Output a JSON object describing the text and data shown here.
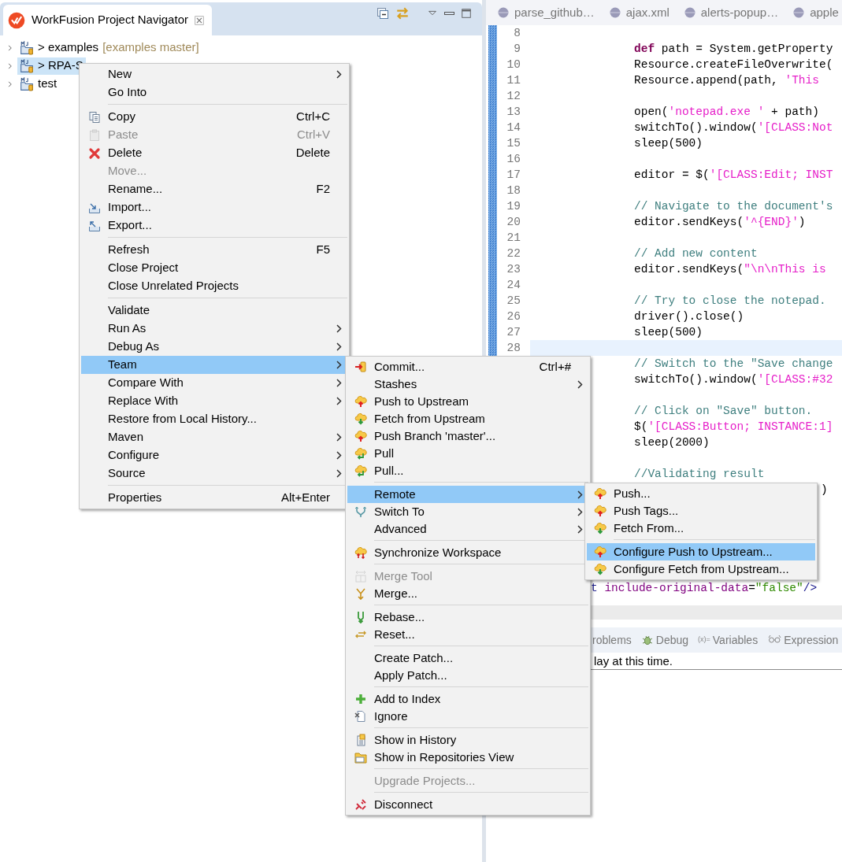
{
  "navigator": {
    "title": "WorkFusion Project Navigator",
    "items": [
      {
        "name": "> examples",
        "branch": "[examples master]",
        "selected": false
      },
      {
        "name": "> RPA-S",
        "selected": true
      },
      {
        "name": "test",
        "selected": false
      }
    ]
  },
  "editor": {
    "tabs": [
      {
        "label": "parse_github…"
      },
      {
        "label": "ajax.xml"
      },
      {
        "label": "alerts-popup…"
      },
      {
        "label": "apple"
      }
    ],
    "lines": [
      {
        "kind": "code",
        "number": "8",
        "current": false
      },
      {
        "kind": "code",
        "number": "9",
        "current": false,
        "segments": [
          {
            "kind": "keyword",
            "text": "def"
          },
          {
            "kind": "plain",
            "text": " path = System.getProperty"
          }
        ]
      },
      {
        "kind": "code",
        "number": "10",
        "current": false,
        "segments": [
          {
            "kind": "plain",
            "text": "Resource.createFileOverwrite("
          }
        ]
      },
      {
        "kind": "code",
        "number": "11",
        "current": false,
        "segments": [
          {
            "kind": "plain",
            "text": "Resource.append(path, "
          },
          {
            "kind": "string",
            "text": "'This"
          }
        ]
      },
      {
        "kind": "code",
        "number": "12",
        "current": false
      },
      {
        "kind": "code",
        "number": "13",
        "current": false,
        "segments": [
          {
            "kind": "plain",
            "text": "open("
          },
          {
            "kind": "string",
            "text": "'notepad.exe '"
          },
          {
            "kind": "plain",
            "text": " + path)"
          }
        ]
      },
      {
        "kind": "code",
        "number": "14",
        "current": false,
        "segments": [
          {
            "kind": "plain",
            "text": "switchTo().window("
          },
          {
            "kind": "string",
            "text": "'[CLASS:Not"
          }
        ]
      },
      {
        "kind": "code",
        "number": "15",
        "current": false,
        "segments": [
          {
            "kind": "plain",
            "text": "sleep(500)"
          }
        ]
      },
      {
        "kind": "code",
        "number": "16",
        "current": false
      },
      {
        "kind": "code",
        "number": "17",
        "current": false,
        "segments": [
          {
            "kind": "plain",
            "text": "editor = $("
          },
          {
            "kind": "string",
            "text": "'[CLASS:Edit; INST"
          }
        ]
      },
      {
        "kind": "code",
        "number": "18",
        "current": false
      },
      {
        "kind": "code",
        "number": "19",
        "current": false,
        "segments": [
          {
            "kind": "comment",
            "text": "// Navigate to the document's"
          }
        ]
      },
      {
        "kind": "code",
        "number": "20",
        "current": false,
        "segments": [
          {
            "kind": "plain",
            "text": "editor.sendKeys("
          },
          {
            "kind": "string",
            "text": "'^{END}'"
          },
          {
            "kind": "plain",
            "text": ")"
          }
        ]
      },
      {
        "kind": "code",
        "number": "21",
        "current": false
      },
      {
        "kind": "code",
        "number": "22",
        "current": false,
        "segments": [
          {
            "kind": "comment",
            "text": "// Add new content"
          }
        ]
      },
      {
        "kind": "code",
        "number": "23",
        "current": false,
        "segments": [
          {
            "kind": "plain",
            "text": "editor.sendKeys("
          },
          {
            "kind": "string",
            "text": "\"\\n\\nThis is"
          }
        ]
      },
      {
        "kind": "code",
        "number": "24",
        "current": false
      },
      {
        "kind": "code",
        "number": "25",
        "current": false,
        "segments": [
          {
            "kind": "comment",
            "text": "// Try to close the notepad."
          }
        ]
      },
      {
        "kind": "code",
        "number": "26",
        "current": false,
        "segments": [
          {
            "kind": "plain",
            "text": "driver().close()"
          }
        ]
      },
      {
        "kind": "code",
        "number": "27",
        "current": false,
        "segments": [
          {
            "kind": "plain",
            "text": "sleep(500)"
          }
        ]
      },
      {
        "kind": "code",
        "number": "28",
        "current": true
      },
      {
        "kind": "code",
        "current": false,
        "segments": [
          {
            "kind": "comment",
            "text": "// Switch to the \"Save change"
          }
        ]
      },
      {
        "kind": "code",
        "current": false,
        "segments": [
          {
            "kind": "plain",
            "text": "switchTo().window("
          },
          {
            "kind": "string",
            "text": "'[CLASS:#32"
          }
        ]
      },
      {
        "kind": "code",
        "current": false
      },
      {
        "kind": "code",
        "current": false,
        "segments": [
          {
            "kind": "comment",
            "text": "// Click on \"Save\" button."
          }
        ]
      },
      {
        "kind": "code",
        "current": false,
        "segments": [
          {
            "kind": "plain",
            "text": "$("
          },
          {
            "kind": "string",
            "text": "'[CLASS:Button; INSTANCE:1]"
          }
        ]
      },
      {
        "kind": "code",
        "current": false,
        "segments": [
          {
            "kind": "plain",
            "text": "sleep(2000)"
          }
        ]
      },
      {
        "kind": "code",
        "current": false
      },
      {
        "kind": "code",
        "current": false,
        "segments": [
          {
            "kind": "comment",
            "text": "//Validating result"
          }
        ]
      },
      {
        "kind": "tail",
        "current": false,
        "segments": [
          {
            "kind": "plain",
            "text": ")"
          }
        ]
      },
      {
        "kind": "code",
        "current": false
      },
      {
        "kind": "code",
        "current": false
      },
      {
        "kind": "code",
        "current": false
      },
      {
        "kind": "code",
        "current": false
      },
      {
        "kind": "code",
        "current": false
      },
      {
        "kind": "xml",
        "current": false,
        "segments": [
          {
            "kind": "xml-tag",
            "text": "t"
          },
          {
            "kind": "xml-attr",
            "text": " include-original-data"
          },
          {
            "kind": "plain",
            "text": "="
          },
          {
            "kind": "xml-value",
            "text": "\"false\""
          },
          {
            "kind": "xml-tag",
            "text": "/>"
          }
        ]
      }
    ]
  },
  "bottom_panel": {
    "tabs": [
      {
        "label": "roblems"
      },
      {
        "label": "Debug"
      },
      {
        "icon_text": "(x)=",
        "label": "Variables"
      },
      {
        "label": "Expression"
      }
    ],
    "message": "lay at this time."
  },
  "context_menu": {
    "items": [
      {
        "kind": "item",
        "label": "New",
        "submenu": true,
        "disabled": false,
        "selected": false
      },
      {
        "kind": "item",
        "label": "Go Into",
        "disabled": false,
        "selected": false
      },
      {
        "kind": "separator"
      },
      {
        "kind": "item",
        "label": "Copy",
        "shortcut": "Ctrl+C",
        "disabled": false,
        "selected": false
      },
      {
        "kind": "item",
        "label": "Paste",
        "shortcut": "Ctrl+V",
        "disabled": true,
        "selected": false
      },
      {
        "kind": "item",
        "label": "Delete",
        "shortcut": "Delete",
        "disabled": false,
        "selected": false
      },
      {
        "kind": "item",
        "label": "Move...",
        "disabled": true,
        "selected": false
      },
      {
        "kind": "item",
        "label": "Rename...",
        "shortcut": "F2",
        "disabled": false,
        "selected": false
      },
      {
        "kind": "item",
        "label": "Import...",
        "disabled": false,
        "selected": false
      },
      {
        "kind": "item",
        "label": "Export...",
        "disabled": false,
        "selected": false
      },
      {
        "kind": "separator"
      },
      {
        "kind": "item",
        "label": "Refresh",
        "shortcut": "F5",
        "disabled": false,
        "selected": false
      },
      {
        "kind": "item",
        "label": "Close Project",
        "disabled": false,
        "selected": false
      },
      {
        "kind": "item",
        "label": "Close Unrelated Projects",
        "disabled": false,
        "selected": false
      },
      {
        "kind": "separator"
      },
      {
        "kind": "item",
        "label": "Validate",
        "disabled": false,
        "selected": false
      },
      {
        "kind": "item",
        "label": "Run As",
        "submenu": true,
        "disabled": false,
        "selected": false
      },
      {
        "kind": "item",
        "label": "Debug As",
        "submenu": true,
        "disabled": false,
        "selected": false
      },
      {
        "kind": "item",
        "label": "Team",
        "submenu": true,
        "disabled": false,
        "selected": true
      },
      {
        "kind": "item",
        "label": "Compare With",
        "submenu": true,
        "disabled": false,
        "selected": false
      },
      {
        "kind": "item",
        "label": "Replace With",
        "submenu": true,
        "disabled": false,
        "selected": false
      },
      {
        "kind": "item",
        "label": "Restore from Local History...",
        "disabled": false,
        "selected": false
      },
      {
        "kind": "item",
        "label": "Maven",
        "submenu": true,
        "disabled": false,
        "selected": false
      },
      {
        "kind": "item",
        "label": "Configure",
        "submenu": true,
        "disabled": false,
        "selected": false
      },
      {
        "kind": "item",
        "label": "Source",
        "submenu": true,
        "disabled": false,
        "selected": false
      },
      {
        "kind": "separator"
      },
      {
        "kind": "item",
        "label": "Properties",
        "shortcut": "Alt+Enter",
        "disabled": false,
        "selected": false
      }
    ]
  },
  "team_menu": {
    "items": [
      {
        "kind": "item",
        "label": "Commit...",
        "shortcut": "Ctrl+#",
        "disabled": false,
        "selected": false
      },
      {
        "kind": "item",
        "label": "Stashes",
        "submenu": true,
        "disabled": false,
        "selected": false
      },
      {
        "kind": "item",
        "label": "Push to Upstream",
        "disabled": false,
        "selected": false
      },
      {
        "kind": "item",
        "label": "Fetch from Upstream",
        "disabled": false,
        "selected": false
      },
      {
        "kind": "item",
        "label": "Push Branch 'master'...",
        "disabled": false,
        "selected": false
      },
      {
        "kind": "item",
        "label": "Pull",
        "disabled": false,
        "selected": false
      },
      {
        "kind": "item",
        "label": "Pull...",
        "disabled": false,
        "selected": false
      },
      {
        "kind": "separator"
      },
      {
        "kind": "item",
        "label": "Remote",
        "submenu": true,
        "disabled": false,
        "selected": true
      },
      {
        "kind": "item",
        "label": "Switch To",
        "submenu": true,
        "disabled": false,
        "selected": false
      },
      {
        "kind": "item",
        "label": "Advanced",
        "submenu": true,
        "disabled": false,
        "selected": false
      },
      {
        "kind": "separator"
      },
      {
        "kind": "item",
        "label": "Synchronize Workspace",
        "disabled": false,
        "selected": false
      },
      {
        "kind": "separator"
      },
      {
        "kind": "item",
        "label": "Merge Tool",
        "disabled": true,
        "selected": false
      },
      {
        "kind": "item",
        "label": "Merge...",
        "disabled": false,
        "selected": false
      },
      {
        "kind": "separator"
      },
      {
        "kind": "item",
        "label": "Rebase...",
        "disabled": false,
        "selected": false
      },
      {
        "kind": "item",
        "label": "Reset...",
        "disabled": false,
        "selected": false
      },
      {
        "kind": "separator"
      },
      {
        "kind": "item",
        "label": "Create Patch...",
        "disabled": false,
        "selected": false
      },
      {
        "kind": "item",
        "label": "Apply Patch...",
        "disabled": false,
        "selected": false
      },
      {
        "kind": "separator"
      },
      {
        "kind": "item",
        "label": "Add to Index",
        "disabled": false,
        "selected": false
      },
      {
        "kind": "item",
        "label": "Ignore",
        "disabled": false,
        "selected": false
      },
      {
        "kind": "separator"
      },
      {
        "kind": "item",
        "label": "Show in History",
        "disabled": false,
        "selected": false
      },
      {
        "kind": "item",
        "label": "Show in Repositories View",
        "disabled": false,
        "selected": false
      },
      {
        "kind": "separator"
      },
      {
        "kind": "item",
        "label": "Upgrade Projects...",
        "disabled": true,
        "selected": false
      },
      {
        "kind": "separator"
      },
      {
        "kind": "item",
        "label": "Disconnect",
        "disabled": false,
        "selected": false
      }
    ]
  },
  "remote_menu": {
    "items": [
      {
        "kind": "item",
        "label": "Push...",
        "disabled": false,
        "selected": false
      },
      {
        "kind": "item",
        "label": "Push Tags...",
        "disabled": false,
        "selected": false
      },
      {
        "kind": "item",
        "label": "Fetch From...",
        "disabled": false,
        "selected": false
      },
      {
        "kind": "separator"
      },
      {
        "kind": "item",
        "label": "Configure Push to Upstream...",
        "disabled": false,
        "selected": true
      },
      {
        "kind": "item",
        "label": "Configure Fetch from Upstream...",
        "disabled": false,
        "selected": false
      }
    ]
  }
}
